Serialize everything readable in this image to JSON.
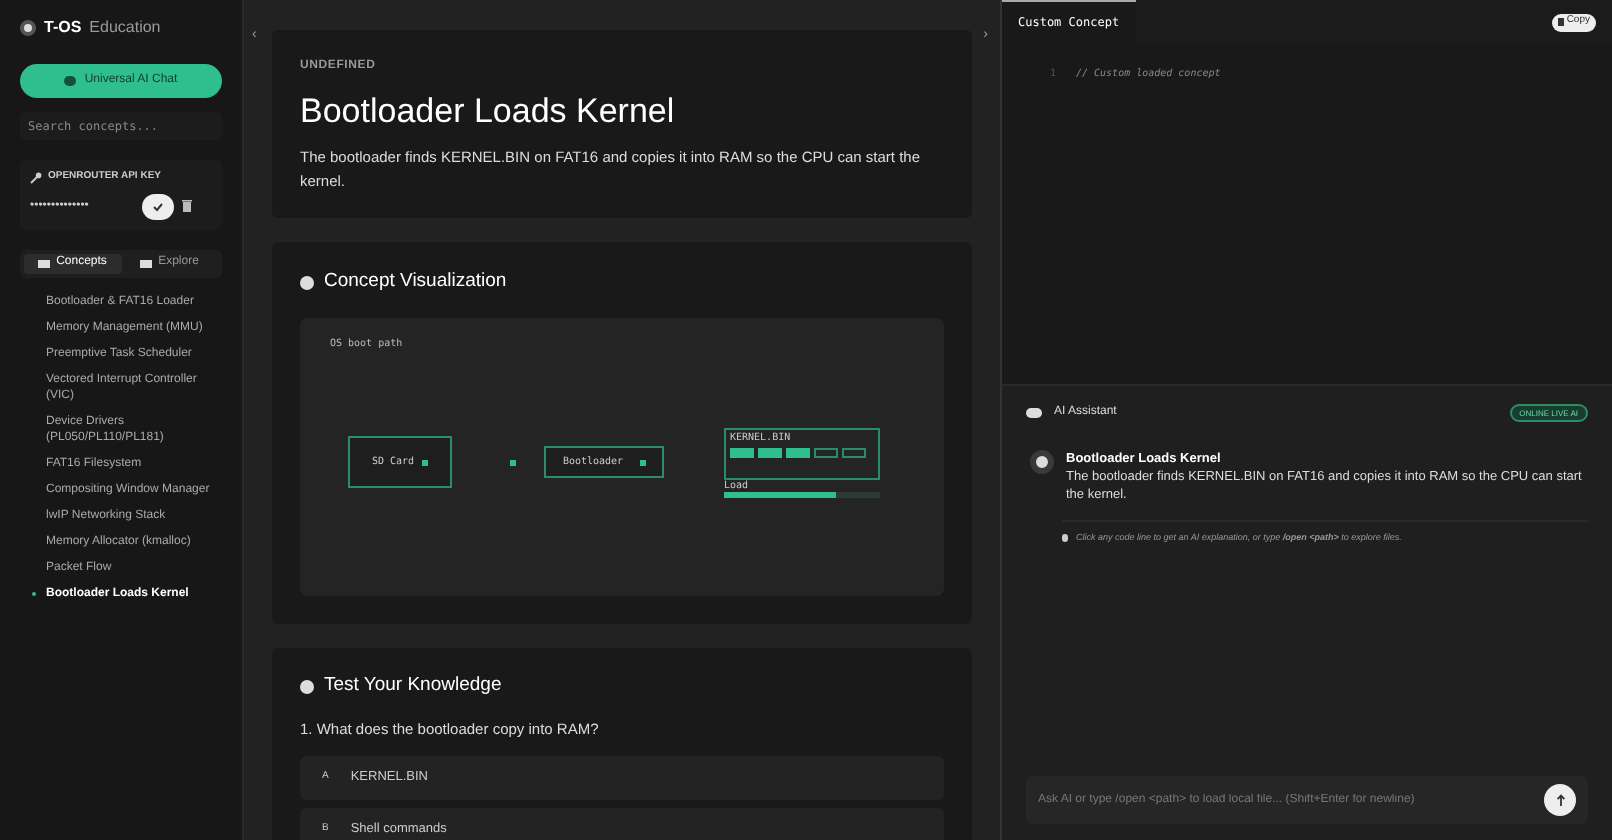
{
  "sidebar": {
    "logo": "T-OS",
    "subtitle": "Education",
    "chat_button": "Universal AI Chat",
    "search": {
      "placeholder": "Search concepts..."
    },
    "api_key": {
      "label": "OPENROUTER API KEY",
      "value": "••••••••••••••"
    },
    "tabs": [
      {
        "label": "Concepts",
        "selected": true
      },
      {
        "label": "Explore",
        "selected": false
      }
    ],
    "items": [
      {
        "label": "Bootloader & FAT16 Loader",
        "selected": false
      },
      {
        "label": "Memory Management (MMU)",
        "selected": false
      },
      {
        "label": "Preemptive Task Scheduler",
        "selected": false
      },
      {
        "label": "Vectored Interrupt Controller (VIC)",
        "selected": false
      },
      {
        "label": "Device Drivers (PL050/PL110/PL181)",
        "selected": false
      },
      {
        "label": "FAT16 Filesystem",
        "selected": false
      },
      {
        "label": "Compositing Window Manager",
        "selected": false
      },
      {
        "label": "lwIP Networking Stack",
        "selected": false
      },
      {
        "label": "Memory Allocator (kmalloc)",
        "selected": false
      },
      {
        "label": "Packet Flow",
        "selected": false
      },
      {
        "label": "Bootloader Loads Kernel",
        "selected": true
      }
    ]
  },
  "main": {
    "nav": {
      "prev": "‹",
      "next": "›"
    },
    "concept": {
      "tag": "UNDEFINED",
      "title": "Bootloader Loads Kernel",
      "description": "The bootloader finds KERNEL.BIN on FAT16 and copies it into RAM so the CPU can start the kernel."
    },
    "visualization": {
      "title": "Concept Visualization",
      "caption": "OS boot path",
      "nodes": [
        "SD Card",
        "Bootloader"
      ],
      "file_label": "KERNEL.BIN",
      "blocks": [
        {
          "filled": true
        },
        {
          "filled": true
        },
        {
          "filled": true
        },
        {
          "filled": false
        },
        {
          "filled": false
        }
      ],
      "load_label": "Load",
      "level": 0.72
    },
    "quiz": {
      "title": "Test Your Knowledge",
      "question": "1. What does the bootloader copy into RAM?",
      "options": [
        {
          "letter": "A",
          "text": "KERNEL.BIN"
        },
        {
          "letter": "B",
          "text": "Shell commands"
        }
      ]
    }
  },
  "editor": {
    "tab": "Custom Concept",
    "copy": "Copy",
    "lines": [
      {
        "number": "1",
        "code": "// Custom loaded concept"
      }
    ]
  },
  "assistant": {
    "title": "AI Assistant",
    "status": "ONLINE LIVE AI",
    "message": {
      "title": "Bootloader Loads Kernel",
      "text": "The bootloader finds KERNEL.BIN on FAT16 and copies it into RAM so the CPU can start the kernel."
    },
    "hint": "Click any code line to get an AI explanation, or type **/open <path>** to explore files.",
    "input": {
      "placeholder": "Ask AI or type /open <path> to load local file... (Shift+Enter for newline)"
    }
  }
}
